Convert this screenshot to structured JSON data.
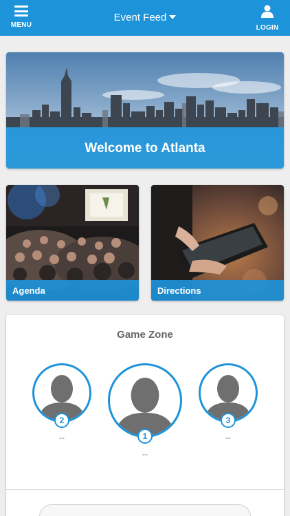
{
  "header": {
    "menu_label": "MENU",
    "title": "Event Feed",
    "login_label": "LOGIN"
  },
  "hero": {
    "caption": "Welcome to Atlanta"
  },
  "tiles": [
    {
      "label": "Agenda"
    },
    {
      "label": "Directions"
    }
  ],
  "game_zone": {
    "title": "Game Zone",
    "players": [
      {
        "rank": "2",
        "score": "--"
      },
      {
        "rank": "1",
        "score": "--"
      },
      {
        "rank": "3",
        "score": "--"
      }
    ]
  },
  "colors": {
    "brand": "#1d93d9"
  }
}
